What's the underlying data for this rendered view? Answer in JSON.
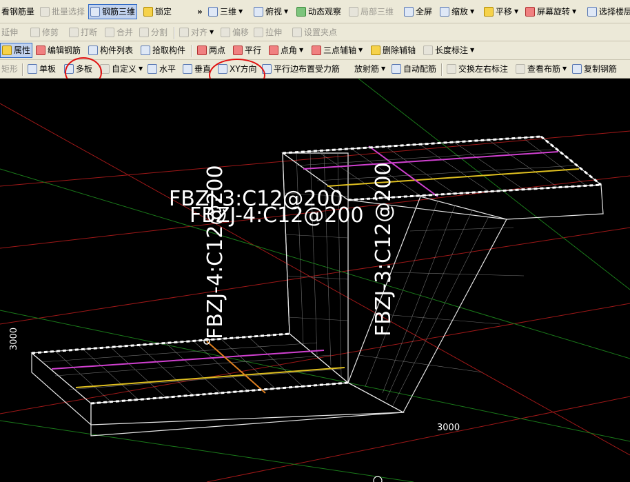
{
  "toolbar1": {
    "view_rebar_qty": "看钢筋量",
    "batch_select": "批量选择",
    "rebar_3d": "钢筋三维",
    "lock": "锁定",
    "overflow": "»",
    "view_3d": "三维",
    "top_view": "俯视",
    "dynamic_view": "动态观察",
    "local_3d": "局部三维",
    "fullscreen": "全屏",
    "zoom": "缩放",
    "pan": "平移",
    "screen_rotate": "屏幕旋转",
    "select_floor": "选择楼层"
  },
  "toolbar2": {
    "extend": "延伸",
    "trim": "修剪",
    "break": "打断",
    "merge": "合并",
    "split": "分割",
    "align": "对齐",
    "offset": "偏移",
    "stretch": "拉伸",
    "set_grip": "设置夹点"
  },
  "toolbar3": {
    "properties": "属性",
    "edit_rebar": "编辑钢筋",
    "component_list": "构件列表",
    "pick_component": "拾取构件",
    "two_points": "两点",
    "parallel": "平行",
    "point_angle": "点角",
    "three_point_axis": "三点辅轴",
    "delete_axis": "删除辅轴",
    "length_dim": "长度标注"
  },
  "toolbar4": {
    "rectangle": "矩形",
    "single_slab": "单板",
    "multi_slab": "多板",
    "custom": "自定义",
    "horizontal": "水平",
    "vertical": "垂直",
    "xy_direction": "XY方向",
    "parallel_edge": "平行边布置受力筋",
    "radial": "放射筋",
    "auto_rebar": "自动配筋",
    "swap_labels": "交换左右标注",
    "view_layout": "查看布筋",
    "copy_rebar": "复制钢筋"
  },
  "viewport": {
    "label_fbzj3_horizontal": "FBZJ-3:C12@200",
    "label_fbzj4_horizontal": "FBZJ-4:C12@200",
    "label_fbzj4_vertical": "FBZJ-4:C12@200",
    "label_fbzj3_vertical": "FBZJ-3:C12@200",
    "dim_left": "3000",
    "dim_bottom": "3000"
  }
}
